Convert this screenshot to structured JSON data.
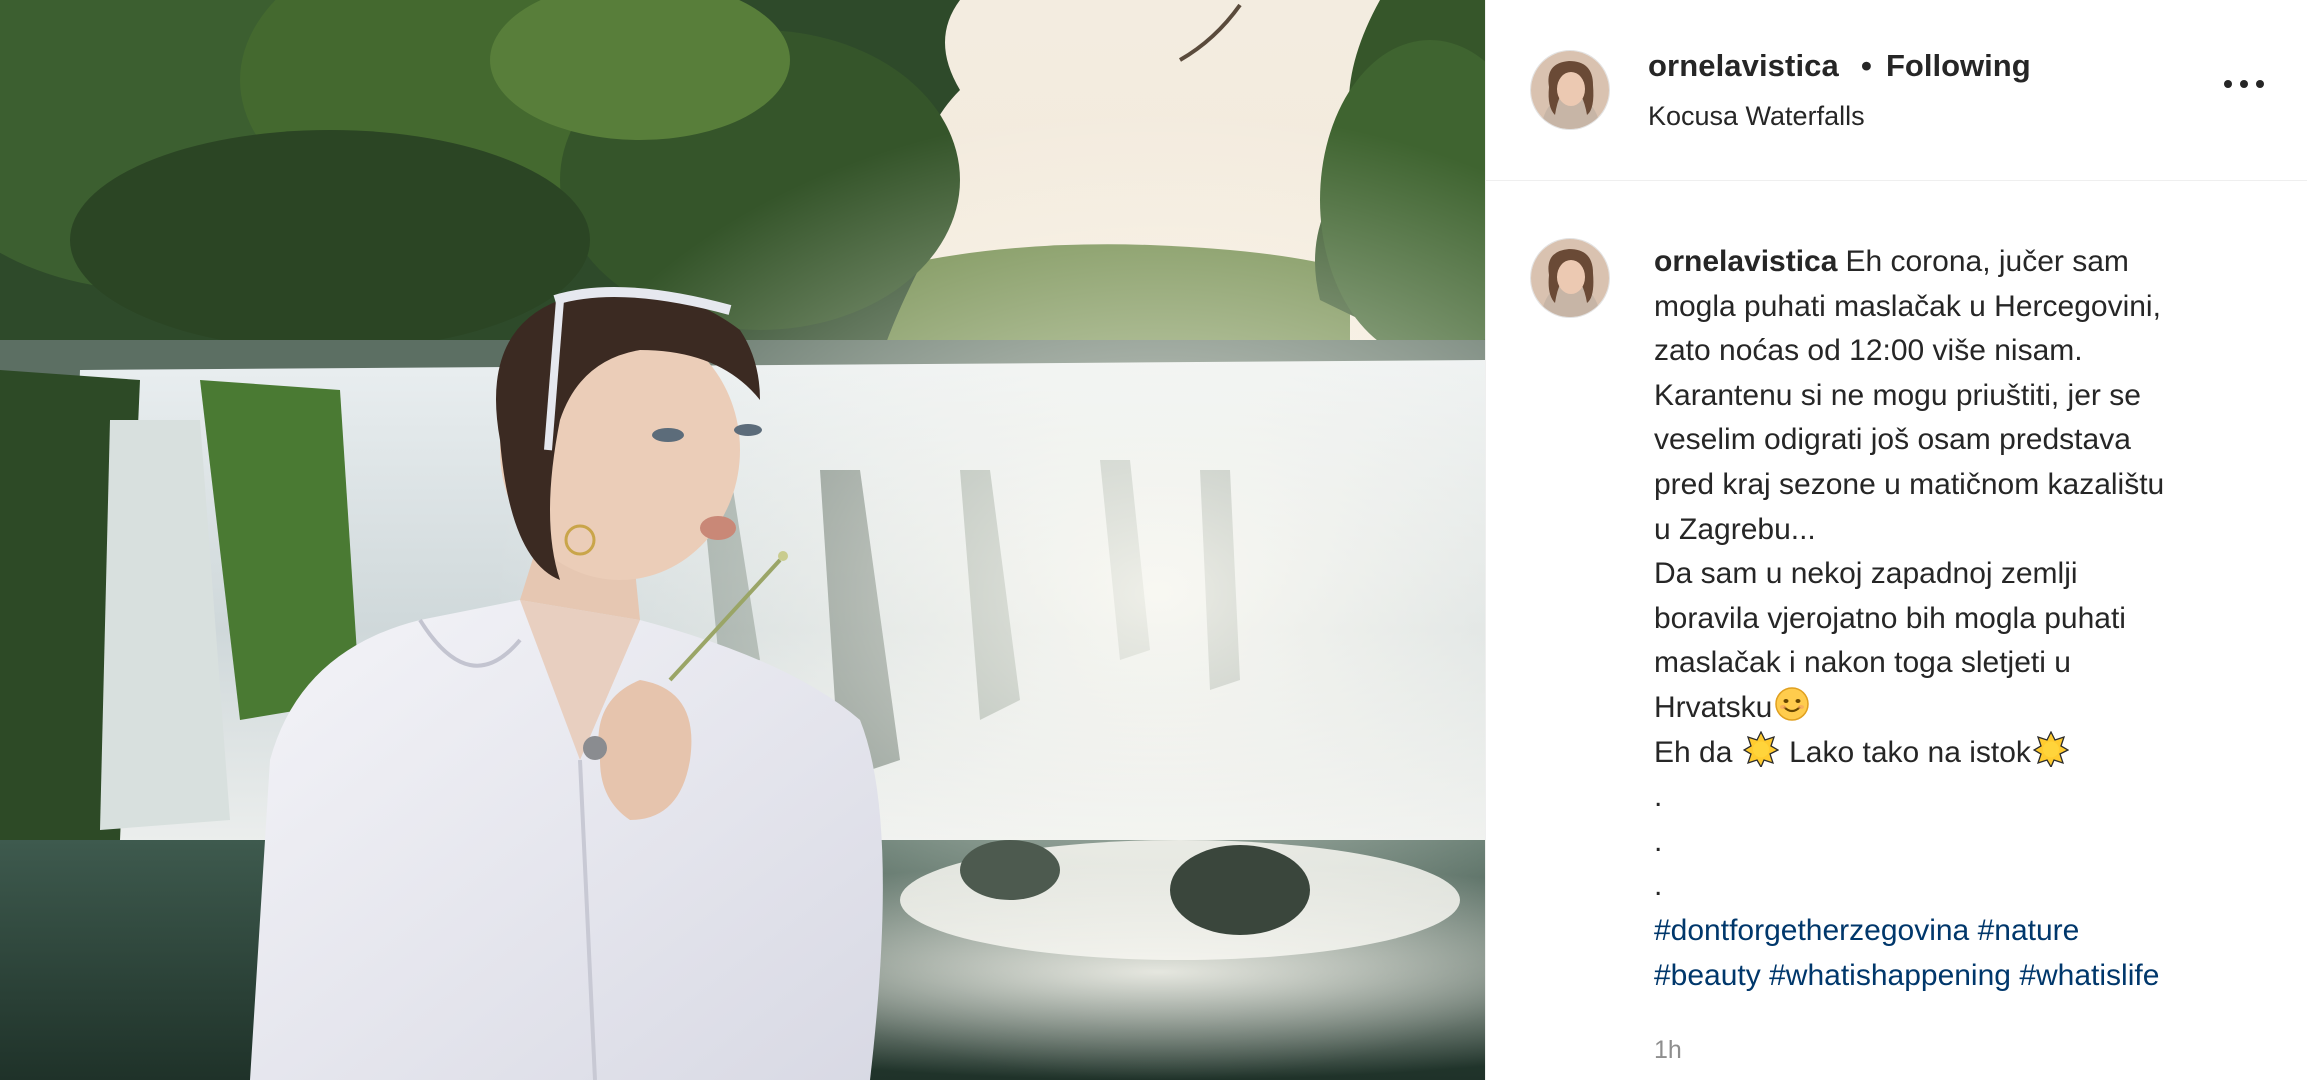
{
  "header": {
    "username": "ornelavistica",
    "separator": "•",
    "follow_status": "Following",
    "location": "Kocusa Waterfalls",
    "more_icon": "more-horizontal-icon"
  },
  "caption": {
    "username": "ornelavistica",
    "lines": [
      "Eh corona, jučer sam",
      "mogla puhati maslačak u Hercegovini,",
      "zato noćas od 12:00 više nisam.",
      "Karantenu si ne mogu priuštiti, jer se",
      "veselim odigrati još osam predstava",
      "pred kraj sezone u matičnom kazalištu",
      "u Zagrebu...",
      "Da sam u nekoj zapadnoj zemlji",
      "boravila vjerojatno bih mogla puhati",
      "maslačak i nakon toga sletjeti u",
      "Hrvatsku",
      "Eh da",
      "Lako tako na istok",
      ".",
      ".",
      "."
    ],
    "emojis": {
      "smile": "smiling-face-emoji",
      "sun": "sun-emoji"
    },
    "hashtags_line1": [
      "#dontforgetherzegovina",
      "#nature"
    ],
    "hashtags_line2": [
      "#beauty",
      "#whatishappening",
      "#whatislife"
    ]
  },
  "timestamp": "1h",
  "colors": {
    "text": "#262626",
    "hashtag": "#00376b",
    "muted": "#8e8e8e",
    "divider": "#efefef"
  }
}
